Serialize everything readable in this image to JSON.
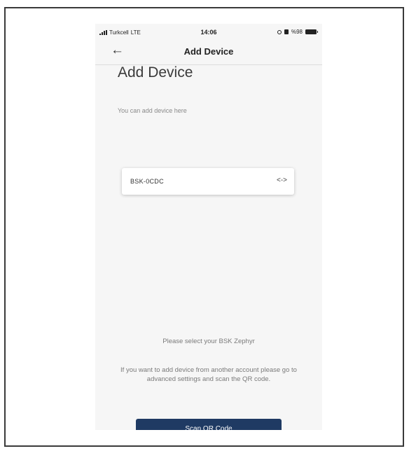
{
  "status_bar": {
    "carrier": "Turkcell",
    "network": "LTE",
    "time": "14:06",
    "battery": "%98"
  },
  "nav": {
    "back_icon": "←",
    "title": "Add Device"
  },
  "page": {
    "heading": "Add Device",
    "subtitle": "You can add device here"
  },
  "device": {
    "name": "BSK-0CDC",
    "connect_icon": "<->"
  },
  "footer": {
    "select_prompt": "Please select your BSK Zephyr",
    "hint": "If you want to add device from another account please go to advanced settings and scan the QR code.",
    "scan_button": "Scan QR Code"
  },
  "colors": {
    "button_background": "#1f3a63",
    "screen_background": "#f6f6f6"
  }
}
